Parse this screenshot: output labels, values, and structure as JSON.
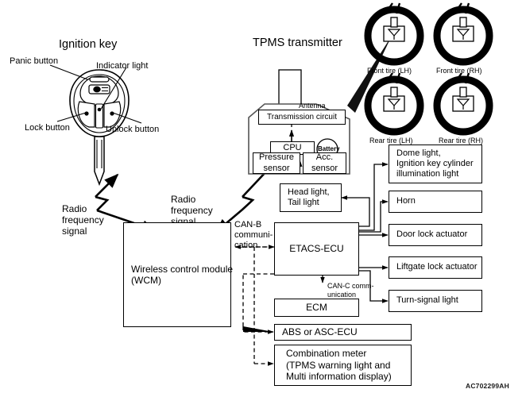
{
  "document": {
    "part_number": "AC702299AH",
    "diagram_type": "TPMS system block diagram"
  },
  "key_section": {
    "title": "Ignition key",
    "callouts": {
      "panic": "Panic button",
      "indicator": "Indicator light",
      "lock": "Lock button",
      "unlock": "Unlock button"
    }
  },
  "tpms_section": {
    "title": "TPMS transmitter",
    "components": {
      "antenna": "Antenna",
      "transmission_circuit": "Transmission circuit",
      "cpu": "CPU",
      "battery": "Battery",
      "pressure_sensor": "Pressure\nsensor",
      "acc_sensor": "Acc.\nsensor"
    }
  },
  "tires": [
    {
      "id": "front-lh",
      "label": "Front tire (LH)"
    },
    {
      "id": "front-rh",
      "label": "Front tire (RH)"
    },
    {
      "id": "rear-lh",
      "label": "Rear tire (LH)"
    },
    {
      "id": "rear-rh",
      "label": "Rear tire (RH)"
    }
  ],
  "signals": {
    "rf_left": "Radio\nfrequency\nsignal",
    "rf_right": "Radio\nfrequency\nsignal",
    "can_b": "CAN-B\ncommuni-\ncation",
    "can_c": "CAN-C comm-\nunication"
  },
  "modules": {
    "wcm": "Wireless control module\n(WCM)",
    "etacs": "ETACS-ECU",
    "ecm": "ECM",
    "abs": "ABS or ASC-ECU",
    "meter": "Combination meter\n(TPMS warning light and\nMulti information display)"
  },
  "outputs": [
    {
      "id": "head-tail-light",
      "label": "Head light,\nTail light"
    },
    {
      "id": "dome-light",
      "label": "Dome light,\nIgnition key cylinder\nillumination light"
    },
    {
      "id": "horn",
      "label": "Horn"
    },
    {
      "id": "door-lock-actuator",
      "label": "Door lock actuator"
    },
    {
      "id": "liftgate-lock-actuator",
      "label": "Liftgate lock actuator"
    },
    {
      "id": "turn-signal-light",
      "label": "Turn-signal light"
    }
  ],
  "colors": {
    "line": "#000000",
    "background": "#ffffff",
    "tpms_border": "#555555"
  }
}
